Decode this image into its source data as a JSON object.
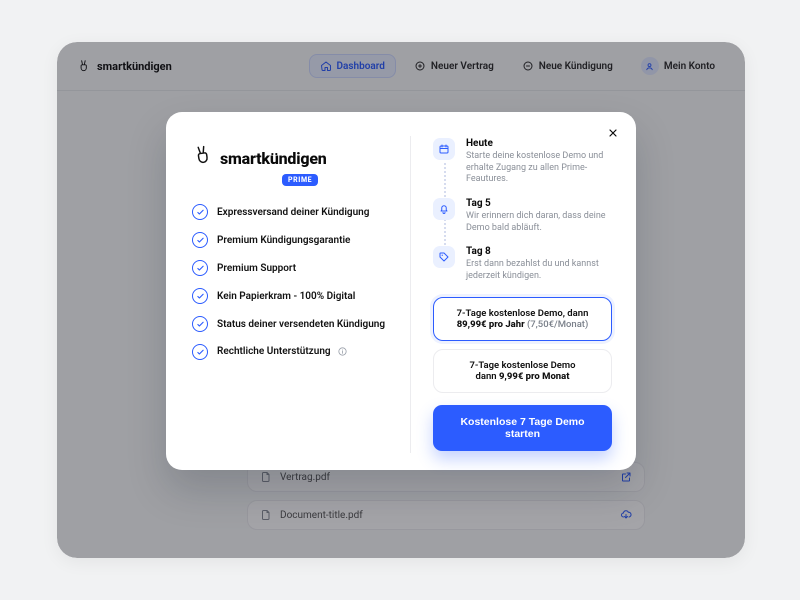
{
  "brand": {
    "name": "smartkündigen"
  },
  "nav": {
    "dashboard": "Dashboard",
    "new_contract": "Neuer Vertrag",
    "new_cancellation": "Neue Kündigung",
    "account": "Mein Konto"
  },
  "files": {
    "row1": "Vertrag.pdf",
    "row2": "Document-title.pdf"
  },
  "modal": {
    "brand": "smartkündigen",
    "prime_badge": "PRIME",
    "features": {
      "f1": "Expressversand deiner Kündigung",
      "f2": "Premium Kündigungsgarantie",
      "f3": "Premium Support",
      "f4": "Kein Papierkram - 100% Digital",
      "f5": "Status deiner versendeten Kündigung",
      "f6": "Rechtliche Unterstützung"
    },
    "timeline": {
      "s1_title": "Heute",
      "s1_desc": "Starte deine kostenlose Demo und erhalte Zugang zu allen Prime-Feautures.",
      "s2_title": "Tag 5",
      "s2_desc": "Wir erinnern dich daran, dass deine Demo bald abläuft.",
      "s3_title": "Tag 8",
      "s3_desc": "Erst dann bezahlst du und kannst jederzeit kündigen."
    },
    "plans": {
      "p1_l1": "7-Tage kostenlose Demo, dann",
      "p1_price": "89,99€ pro Jahr",
      "p1_sub": " (7,50€/Monat)",
      "p2_l1": "7-Tage kostenlose Demo",
      "p2_l2a": "dann ",
      "p2_price": "9,99€ pro Monat"
    },
    "cta": "Kostenlose 7 Tage Demo starten"
  }
}
